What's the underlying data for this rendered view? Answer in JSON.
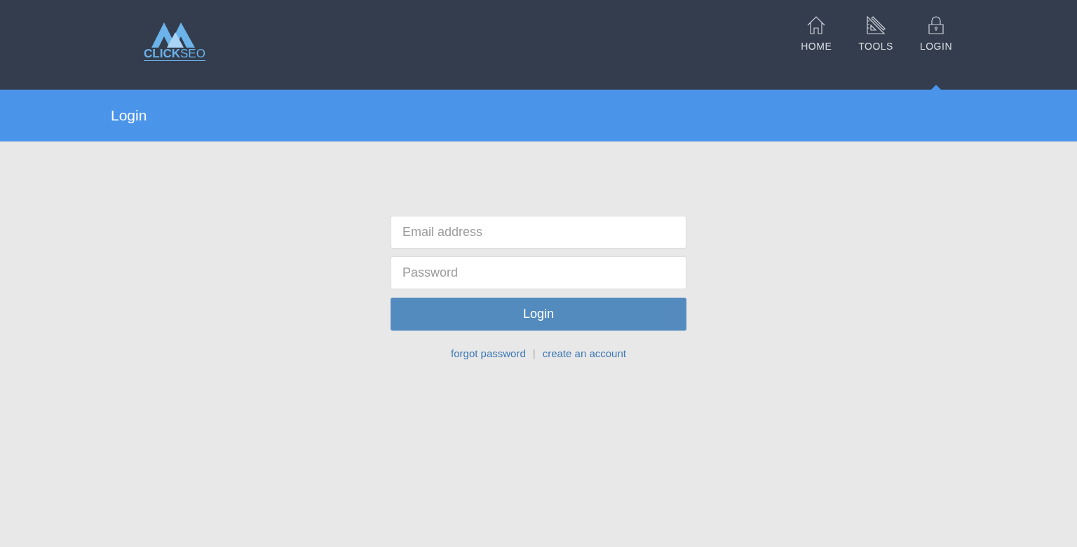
{
  "logo": {
    "text": "**CLICK**SEO"
  },
  "nav": [
    {
      "kind": "home",
      "label": "HOME",
      "selected": false
    },
    {
      "kind": "tools",
      "label": "TOOLS",
      "selected": false
    },
    {
      "kind": "lock",
      "label": "LOGIN",
      "selected": true
    }
  ],
  "page_title": "Login",
  "form": {
    "email": {
      "placeholder": "Email address"
    },
    "password": {
      "placeholder": "Password"
    },
    "submit": "Login"
  },
  "links": {
    "forgot": "forgot password",
    "separator": "|",
    "create": "create an account"
  }
}
